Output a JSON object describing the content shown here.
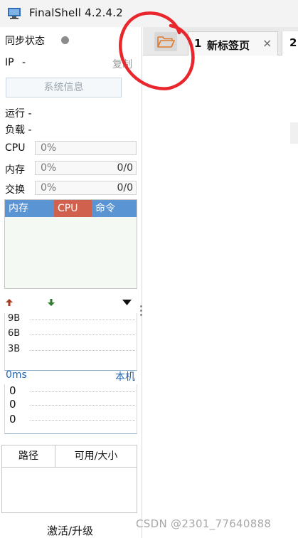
{
  "window": {
    "title": "FinalShell 4.2.4.2"
  },
  "sidebar": {
    "sync_status_label": "同步状态",
    "ip_label": "IP",
    "ip_value": "-",
    "copy_label": "复制",
    "sysinfo_button": "系统信息",
    "uptime_label": "运行 -",
    "load_label": "负载 -",
    "cpu": {
      "label": "CPU",
      "percent": "0%"
    },
    "memory": {
      "label": "内存",
      "percent": "0%",
      "ratio": "0/0"
    },
    "swap": {
      "label": "交换",
      "percent": "0%",
      "ratio": "0/0"
    },
    "process_table": {
      "columns": [
        "内存",
        "CPU",
        "命令"
      ],
      "colors": {
        "mem": "#5b94d2",
        "cpu": "#d0624d",
        "cmd": "#5b94d2"
      }
    },
    "network": {
      "upload_color": "#a83a1e",
      "download_color": "#2d7a2d",
      "scale": [
        "9B",
        "6B",
        "3B"
      ]
    },
    "latency": {
      "value": "0ms",
      "host": "本机",
      "scale": [
        "0",
        "0",
        "0"
      ]
    },
    "disk_table": {
      "columns": [
        "路径",
        "可用/大小"
      ]
    },
    "activate_label": "激活/升级"
  },
  "tabs": {
    "open_folder_icon": "folder-open-icon",
    "items": [
      {
        "number": "1",
        "label": "新标签页",
        "close": "×"
      },
      {
        "number": "2"
      }
    ]
  },
  "watermark": "CSDN @2301_77640888",
  "colors": {
    "accent_blue": "#1f66b5",
    "annotation_red": "#e8262b"
  }
}
